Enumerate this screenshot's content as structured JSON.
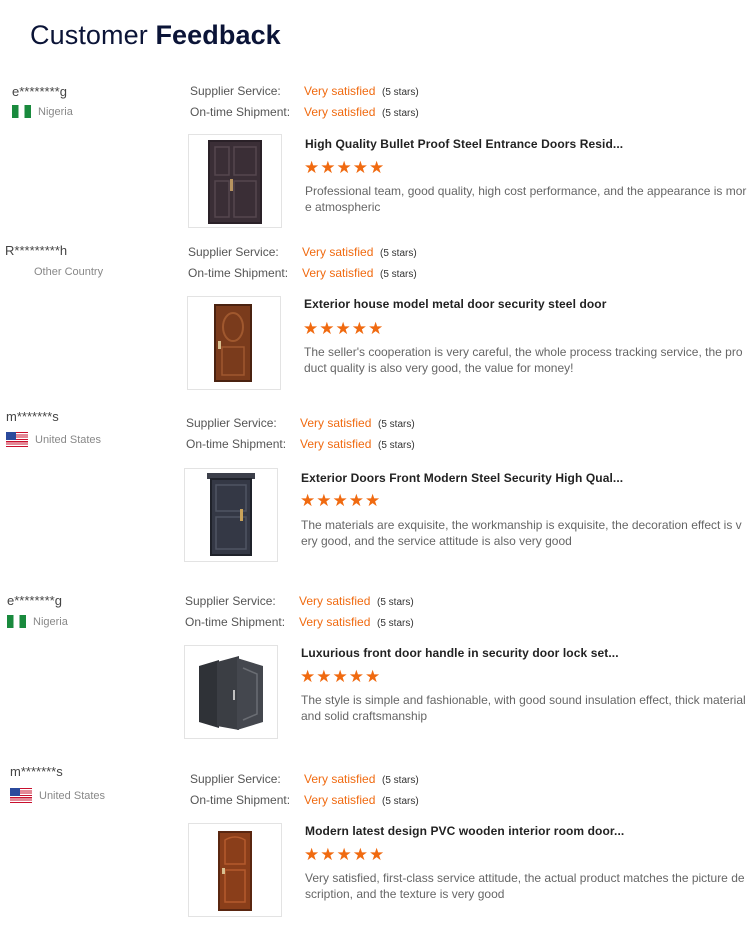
{
  "page": {
    "title_regular": "Customer ",
    "title_bold": "Feedback"
  },
  "labels": {
    "supplier_service": "Supplier Service:",
    "ontime_shipment": "On-time Shipment:"
  },
  "reviews": [
    {
      "user": "e********g",
      "country": "Nigeria",
      "flag": "ng-flag-icon",
      "supplier_value": "Very satisfied",
      "supplier_stars": "(5 stars)",
      "shipment_value": "Very satisfied",
      "shipment_stars": "(5 stars)",
      "product_title": "High Quality Bullet Proof Steel Entrance Doors Resid...",
      "rating": "★★★★★",
      "comment": "Professional team, good quality, high cost performance, and the appearance is more atmospheric"
    },
    {
      "user": "R*********h",
      "country": "Other Country",
      "flag": "",
      "supplier_value": "Very satisfied",
      "supplier_stars": "(5 stars)",
      "shipment_value": "Very satisfied",
      "shipment_stars": "(5 stars)",
      "product_title": "Exterior house model metal door security steel door",
      "rating": "★★★★★",
      "comment": "The seller's cooperation is very careful, the whole process tracking service, the product quality is also very good, the value for money!"
    },
    {
      "user": "m*******s",
      "country": "United States",
      "flag": "us-flag-icon",
      "supplier_value": "Very satisfied",
      "supplier_stars": "(5 stars)",
      "shipment_value": "Very satisfied",
      "shipment_stars": "(5 stars)",
      "product_title": "Exterior Doors Front Modern Steel Security High Qual...",
      "rating": "★★★★★",
      "comment": "The materials are exquisite, the workmanship is exquisite, the decoration effect is very good, and the service attitude is also very good"
    },
    {
      "user": "e********g",
      "country": "Nigeria",
      "flag": "ng-flag-icon",
      "supplier_value": "Very satisfied",
      "supplier_stars": "(5 stars)",
      "shipment_value": "Very satisfied",
      "shipment_stars": "(5 stars)",
      "product_title": "Luxurious front door handle in security door lock set...",
      "rating": "★★★★★",
      "comment": "The style is simple and fashionable, with good sound insulation effect, thick material and solid craftsmanship"
    },
    {
      "user": "m*******s",
      "country": "United States",
      "flag": "us-flag-icon",
      "supplier_value": "Very satisfied",
      "supplier_stars": "(5 stars)",
      "shipment_value": "Very satisfied",
      "shipment_stars": "(5 stars)",
      "product_title": "Modern latest design PVC wooden interior room door...",
      "rating": "★★★★★",
      "comment": "Very satisfied, first-class service attitude, the actual product matches the picture description, and the texture is very good"
    }
  ]
}
